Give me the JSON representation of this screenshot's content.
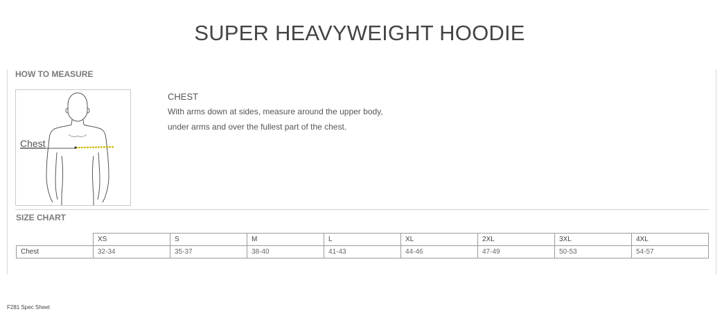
{
  "title": "SUPER HEAVYWEIGHT HOODIE",
  "how_to_measure": {
    "heading": "HOW TO MEASURE",
    "figure_label": "Chest",
    "measure": {
      "name": "CHEST",
      "description": "With arms down at sides, measure around the upper body, under arms and over the fullest part of the chest."
    }
  },
  "size_chart": {
    "heading": "SIZE CHART",
    "sizes": [
      "XS",
      "S",
      "M",
      "L",
      "XL",
      "2XL",
      "3XL",
      "4XL"
    ],
    "rows": [
      {
        "label": "Chest",
        "values": [
          "32-34",
          "35-37",
          "38-40",
          "41-43",
          "44-46",
          "47-49",
          "50-53",
          "54-57"
        ]
      }
    ]
  },
  "footer": "F281 Spec Sheet",
  "colors": {
    "measure_line": "#c8b400",
    "text": "#555555"
  }
}
